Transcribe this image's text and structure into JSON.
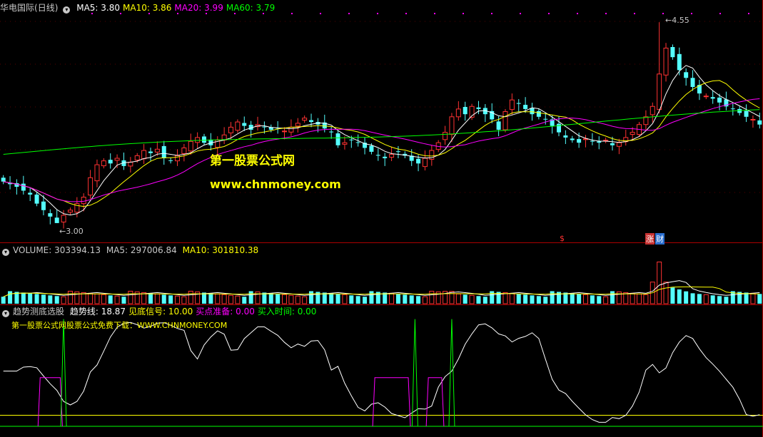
{
  "main_panel": {
    "stock_name": "华电国际",
    "period": "(日线)",
    "indicators": [
      {
        "label": "MA5: 3.80",
        "color": "#ffffff"
      },
      {
        "label": "MA10: 3.86",
        "color": "#ffff00"
      },
      {
        "label": "MA20: 3.99",
        "color": "#ff00ff"
      },
      {
        "label": "MA60: 3.79",
        "color": "#00ff00"
      }
    ],
    "high_label": "4.55",
    "low_label": "3.00",
    "badge_s": "$",
    "badge_zhang": "涨",
    "badge_cai": "财",
    "watermark_cn": "第一股票公式网",
    "watermark_url": "www.chnmoney.com"
  },
  "volume_panel": {
    "title": "VOLUME: 303394.13",
    "ma5": "MA5: 297006.84",
    "ma10": "MA10: 301810.38"
  },
  "indicator_panel": {
    "name": "趋势测底选股",
    "items": [
      {
        "label": "趋势线: 18.87",
        "color": "#ffffff"
      },
      {
        "label": "见底信号: 10.00",
        "color": "#ffff00"
      },
      {
        "label": "买点准备: 0.00",
        "color": "#ff00ff"
      },
      {
        "label": "买入时间: 0.00",
        "color": "#00ff00"
      }
    ],
    "note": "第一股票公式网股票公式免费下载：WWW.CHNMONEY.COM"
  },
  "colors": {
    "up": "#ff3232",
    "down": "#54ffff",
    "ma5": "#ffffff",
    "ma10": "#ffff00",
    "ma20": "#ff00ff",
    "ma60": "#00ff00",
    "divider": "#aa0000"
  },
  "chart_data": {
    "type": "candlestick",
    "price_range": [
      3.0,
      4.55
    ],
    "close": [
      3.32,
      3.3,
      3.28,
      3.25,
      3.22,
      3.15,
      3.1,
      3.05,
      3.0,
      3.06,
      3.1,
      3.15,
      3.2,
      3.35,
      3.45,
      3.48,
      3.46,
      3.5,
      3.44,
      3.47,
      3.52,
      3.56,
      3.54,
      3.57,
      3.5,
      3.48,
      3.52,
      3.58,
      3.63,
      3.66,
      3.62,
      3.6,
      3.64,
      3.68,
      3.74,
      3.78,
      3.75,
      3.72,
      3.76,
      3.74,
      3.72,
      3.73,
      3.71,
      3.74,
      3.77,
      3.81,
      3.78,
      3.76,
      3.73,
      3.7,
      3.6,
      3.62,
      3.64,
      3.62,
      3.58,
      3.55,
      3.52,
      3.5,
      3.53,
      3.55,
      3.52,
      3.48,
      3.46,
      3.5,
      3.56,
      3.62,
      3.7,
      3.82,
      3.88,
      3.84,
      3.9,
      3.88,
      3.84,
      3.8,
      3.72,
      3.86,
      3.95,
      3.92,
      3.88,
      3.84,
      3.82,
      3.8,
      3.75,
      3.7,
      3.66,
      3.64,
      3.62,
      3.65,
      3.63,
      3.62,
      3.64,
      3.6,
      3.62,
      3.66,
      3.7,
      3.76,
      3.82,
      3.9,
      4.15,
      4.35,
      4.28,
      4.18,
      4.12,
      4.05,
      4.0,
      3.98,
      3.96,
      3.93,
      3.9,
      3.88,
      3.85,
      3.82,
      3.8,
      3.76
    ],
    "volume_max": 600000
  }
}
